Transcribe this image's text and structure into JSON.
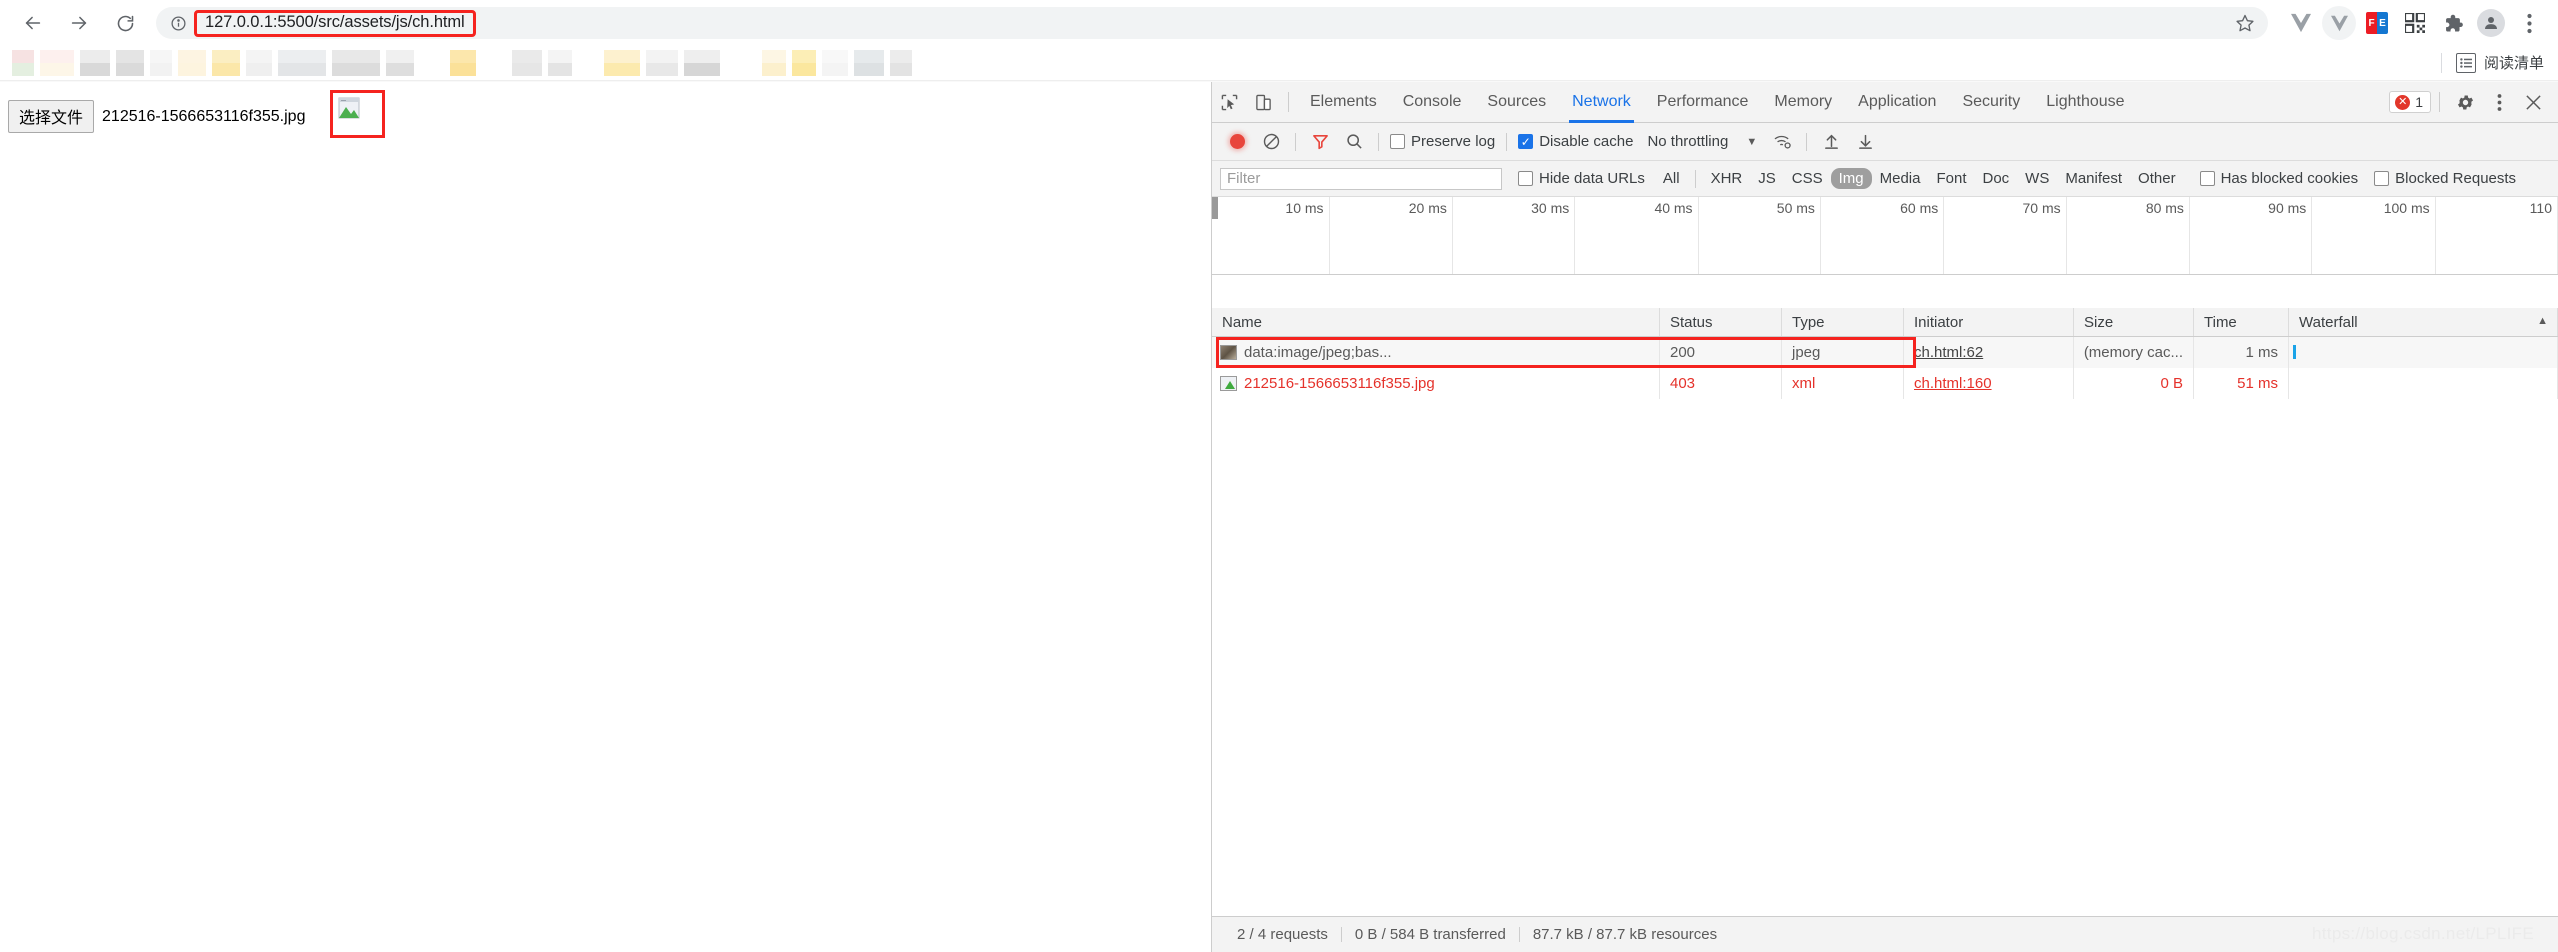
{
  "browser": {
    "back_label": "back-arrow",
    "forward_label": "forward-arrow",
    "reload_label": "reload",
    "url": "127.0.0.1:5500/src/assets/js/ch.html",
    "bookmark_star": "star-icon",
    "toolbar_icons": [
      "vue-devtools-icon",
      "vue-devtools-active-icon",
      "fe-helper-icon",
      "qr-code-icon",
      "extensions-puzzle-icon",
      "profile-avatar-icon",
      "chrome-menu-icon"
    ],
    "fe_left": "F",
    "fe_right": "E",
    "reading_list_label": "阅读清单"
  },
  "page": {
    "file_input_button": "选择文件",
    "file_name": "212516-1566653116f355.jpg",
    "image_alt": "broken-image"
  },
  "devtools": {
    "tabs": [
      {
        "label": "Elements",
        "active": false
      },
      {
        "label": "Console",
        "active": false
      },
      {
        "label": "Sources",
        "active": false
      },
      {
        "label": "Network",
        "active": true
      },
      {
        "label": "Performance",
        "active": false
      },
      {
        "label": "Memory",
        "active": false
      },
      {
        "label": "Application",
        "active": false
      },
      {
        "label": "Security",
        "active": false
      },
      {
        "label": "Lighthouse",
        "active": false
      }
    ],
    "error_count": "1",
    "settings_icon": "gear-icon",
    "more_icon": "kebab-menu-icon",
    "close_icon": "close-icon",
    "inspect_icon": "inspect-element-icon",
    "device_icon": "device-toolbar-icon",
    "network_toolbar": {
      "record_label": "record-button",
      "clear_label": "clear-button",
      "filter_label": "filter-button",
      "search_label": "search-button",
      "preserve_log": "Preserve log",
      "preserve_log_checked": false,
      "disable_cache": "Disable cache",
      "disable_cache_checked": true,
      "throttling": "No throttling",
      "wifi_icon": "network-conditions-icon",
      "import_icon": "import-har-icon",
      "export_icon": "export-har-icon"
    },
    "filter_bar": {
      "placeholder": "Filter",
      "value": "",
      "hide_data_urls": "Hide data URLs",
      "hide_data_urls_checked": false,
      "types": [
        "All",
        "XHR",
        "JS",
        "CSS",
        "Img",
        "Media",
        "Font",
        "Doc",
        "WS",
        "Manifest",
        "Other"
      ],
      "selected_type": "Img",
      "has_blocked_cookies": "Has blocked cookies",
      "has_blocked_cookies_checked": false,
      "blocked_requests": "Blocked Requests",
      "blocked_requests_checked": false
    },
    "timeline": {
      "ticks": [
        "10 ms",
        "20 ms",
        "30 ms",
        "40 ms",
        "50 ms",
        "60 ms",
        "70 ms",
        "80 ms",
        "90 ms",
        "100 ms",
        "110"
      ]
    },
    "table": {
      "columns": [
        "Name",
        "Status",
        "Type",
        "Initiator",
        "Size",
        "Time",
        "Waterfall"
      ],
      "sort_indicator": "▲",
      "rows": [
        {
          "icon": "jpeg-thumbnail-icon",
          "name": "data:image/jpeg;bas...",
          "status": "200",
          "type": "jpeg",
          "initiator": "ch.html:62",
          "size": "(memory cac...",
          "time": "1 ms",
          "error": false
        },
        {
          "icon": "broken-image-icon",
          "name": "212516-1566653116f355.jpg",
          "status": "403",
          "type": "xml",
          "initiator": "ch.html:160",
          "size": "0 B",
          "time": "51 ms",
          "error": true
        }
      ]
    },
    "status_bar": {
      "requests": "2 / 4 requests",
      "transferred": "0 B / 584 B transferred",
      "resources": "87.7 kB / 87.7 kB resources"
    },
    "watermark": "https://blog.csdn.net/LPLIFE"
  }
}
